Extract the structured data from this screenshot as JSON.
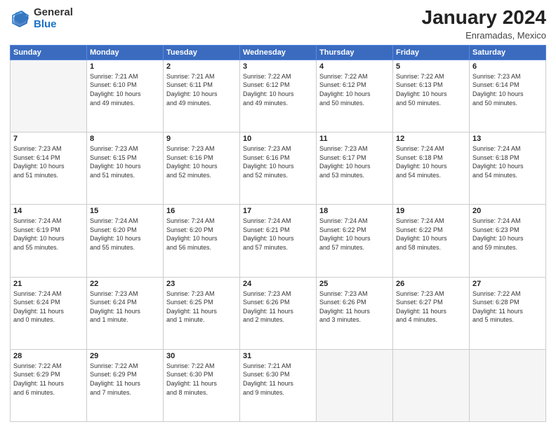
{
  "header": {
    "logo_general": "General",
    "logo_blue": "Blue",
    "month_title": "January 2024",
    "subtitle": "Enramadas, Mexico"
  },
  "days_of_week": [
    "Sunday",
    "Monday",
    "Tuesday",
    "Wednesday",
    "Thursday",
    "Friday",
    "Saturday"
  ],
  "weeks": [
    [
      {
        "num": "",
        "info": ""
      },
      {
        "num": "1",
        "info": "Sunrise: 7:21 AM\nSunset: 6:10 PM\nDaylight: 10 hours\nand 49 minutes."
      },
      {
        "num": "2",
        "info": "Sunrise: 7:21 AM\nSunset: 6:11 PM\nDaylight: 10 hours\nand 49 minutes."
      },
      {
        "num": "3",
        "info": "Sunrise: 7:22 AM\nSunset: 6:12 PM\nDaylight: 10 hours\nand 49 minutes."
      },
      {
        "num": "4",
        "info": "Sunrise: 7:22 AM\nSunset: 6:12 PM\nDaylight: 10 hours\nand 50 minutes."
      },
      {
        "num": "5",
        "info": "Sunrise: 7:22 AM\nSunset: 6:13 PM\nDaylight: 10 hours\nand 50 minutes."
      },
      {
        "num": "6",
        "info": "Sunrise: 7:23 AM\nSunset: 6:14 PM\nDaylight: 10 hours\nand 50 minutes."
      }
    ],
    [
      {
        "num": "7",
        "info": "Sunrise: 7:23 AM\nSunset: 6:14 PM\nDaylight: 10 hours\nand 51 minutes."
      },
      {
        "num": "8",
        "info": "Sunrise: 7:23 AM\nSunset: 6:15 PM\nDaylight: 10 hours\nand 51 minutes."
      },
      {
        "num": "9",
        "info": "Sunrise: 7:23 AM\nSunset: 6:16 PM\nDaylight: 10 hours\nand 52 minutes."
      },
      {
        "num": "10",
        "info": "Sunrise: 7:23 AM\nSunset: 6:16 PM\nDaylight: 10 hours\nand 52 minutes."
      },
      {
        "num": "11",
        "info": "Sunrise: 7:23 AM\nSunset: 6:17 PM\nDaylight: 10 hours\nand 53 minutes."
      },
      {
        "num": "12",
        "info": "Sunrise: 7:24 AM\nSunset: 6:18 PM\nDaylight: 10 hours\nand 54 minutes."
      },
      {
        "num": "13",
        "info": "Sunrise: 7:24 AM\nSunset: 6:18 PM\nDaylight: 10 hours\nand 54 minutes."
      }
    ],
    [
      {
        "num": "14",
        "info": "Sunrise: 7:24 AM\nSunset: 6:19 PM\nDaylight: 10 hours\nand 55 minutes."
      },
      {
        "num": "15",
        "info": "Sunrise: 7:24 AM\nSunset: 6:20 PM\nDaylight: 10 hours\nand 55 minutes."
      },
      {
        "num": "16",
        "info": "Sunrise: 7:24 AM\nSunset: 6:20 PM\nDaylight: 10 hours\nand 56 minutes."
      },
      {
        "num": "17",
        "info": "Sunrise: 7:24 AM\nSunset: 6:21 PM\nDaylight: 10 hours\nand 57 minutes."
      },
      {
        "num": "18",
        "info": "Sunrise: 7:24 AM\nSunset: 6:22 PM\nDaylight: 10 hours\nand 57 minutes."
      },
      {
        "num": "19",
        "info": "Sunrise: 7:24 AM\nSunset: 6:22 PM\nDaylight: 10 hours\nand 58 minutes."
      },
      {
        "num": "20",
        "info": "Sunrise: 7:24 AM\nSunset: 6:23 PM\nDaylight: 10 hours\nand 59 minutes."
      }
    ],
    [
      {
        "num": "21",
        "info": "Sunrise: 7:24 AM\nSunset: 6:24 PM\nDaylight: 11 hours\nand 0 minutes."
      },
      {
        "num": "22",
        "info": "Sunrise: 7:23 AM\nSunset: 6:24 PM\nDaylight: 11 hours\nand 1 minute."
      },
      {
        "num": "23",
        "info": "Sunrise: 7:23 AM\nSunset: 6:25 PM\nDaylight: 11 hours\nand 1 minute."
      },
      {
        "num": "24",
        "info": "Sunrise: 7:23 AM\nSunset: 6:26 PM\nDaylight: 11 hours\nand 2 minutes."
      },
      {
        "num": "25",
        "info": "Sunrise: 7:23 AM\nSunset: 6:26 PM\nDaylight: 11 hours\nand 3 minutes."
      },
      {
        "num": "26",
        "info": "Sunrise: 7:23 AM\nSunset: 6:27 PM\nDaylight: 11 hours\nand 4 minutes."
      },
      {
        "num": "27",
        "info": "Sunrise: 7:22 AM\nSunset: 6:28 PM\nDaylight: 11 hours\nand 5 minutes."
      }
    ],
    [
      {
        "num": "28",
        "info": "Sunrise: 7:22 AM\nSunset: 6:29 PM\nDaylight: 11 hours\nand 6 minutes."
      },
      {
        "num": "29",
        "info": "Sunrise: 7:22 AM\nSunset: 6:29 PM\nDaylight: 11 hours\nand 7 minutes."
      },
      {
        "num": "30",
        "info": "Sunrise: 7:22 AM\nSunset: 6:30 PM\nDaylight: 11 hours\nand 8 minutes."
      },
      {
        "num": "31",
        "info": "Sunrise: 7:21 AM\nSunset: 6:30 PM\nDaylight: 11 hours\nand 9 minutes."
      },
      {
        "num": "",
        "info": ""
      },
      {
        "num": "",
        "info": ""
      },
      {
        "num": "",
        "info": ""
      }
    ]
  ]
}
